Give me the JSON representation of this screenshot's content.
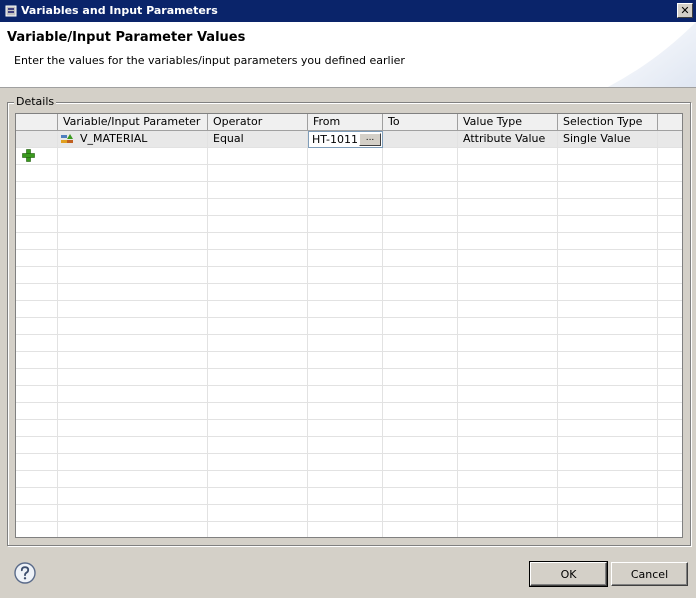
{
  "window": {
    "title": "Variables and Input Parameters",
    "close_glyph": "✕"
  },
  "header": {
    "title": "Variable/Input Parameter Values",
    "description": "Enter the values for the variables/input parameters you defined earlier"
  },
  "group": {
    "label": "Details"
  },
  "table": {
    "columns": [
      "Variable/Input Parameter",
      "Operator",
      "From",
      "To",
      "Value Type",
      "Selection Type"
    ],
    "rows": [
      {
        "name": "V_MATERIAL",
        "operator": "Equal",
        "from": "HT-1011",
        "to": "",
        "value_type": "Attribute Value",
        "selection_type": "Single Value"
      }
    ],
    "browse_label": "...",
    "add_icon": "add-row-icon",
    "variable_icon": "variable-icon"
  },
  "buttons": {
    "ok": "OK",
    "cancel": "Cancel"
  },
  "icons": {
    "help": "help-icon",
    "app": "app-icon"
  },
  "colors": {
    "titlebar": "#0a246a",
    "add_green": "#3a9a1e"
  }
}
